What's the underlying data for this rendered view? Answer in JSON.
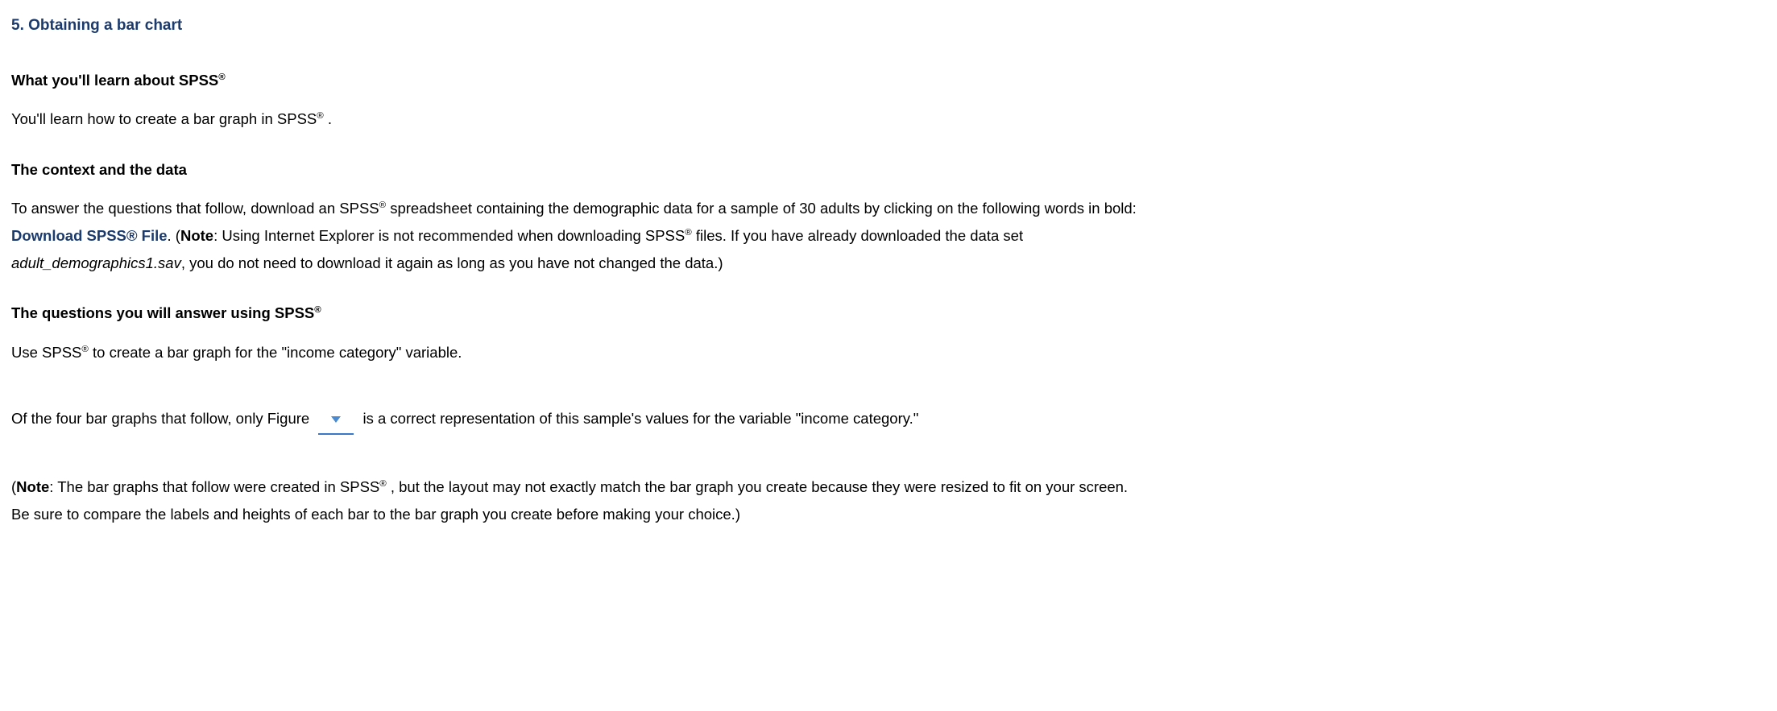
{
  "section_title": "5. Obtaining a bar chart",
  "reg": "®",
  "h1_prefix": "What you'll learn about SPSS",
  "p1_prefix": "You'll learn how to create a bar graph in SPSS",
  "p1_suffix": " .",
  "h2": "The context and the data",
  "p2_a": "To answer the questions that follow, download an SPSS",
  "p2_b": " spreadsheet containing the demographic data for a sample of 30 adults by clicking on the following words in bold: ",
  "link_text": "Download SPSS® File",
  "p2_c": ". (",
  "note_label": "Note",
  "p2_d": ": Using Internet Explorer is not recommended when downloading SPSS",
  "p2_e": " files. If you have already downloaded the data set ",
  "filename": "adult_demographics1.sav",
  "p2_f": ", you do not need to download it again as long as you have not changed the data.)",
  "h3_prefix": "The questions you will answer using SPSS",
  "p3_a": "Use SPSS",
  "p3_b": " to create a bar graph for the \"income category\" variable.",
  "p4_a": "Of the four bar graphs that follow, only Figure ",
  "p4_b": " is a correct representation of this sample's values for the variable \"income category.\"",
  "p5_a": "(",
  "p5_b": ": The bar graphs that follow were created in SPSS",
  "p5_c": " , but the layout may not exactly match the bar graph you create because they were resized to fit on your screen. Be sure to compare the labels and heights of each bar to the bar graph you create before making your choice.)"
}
